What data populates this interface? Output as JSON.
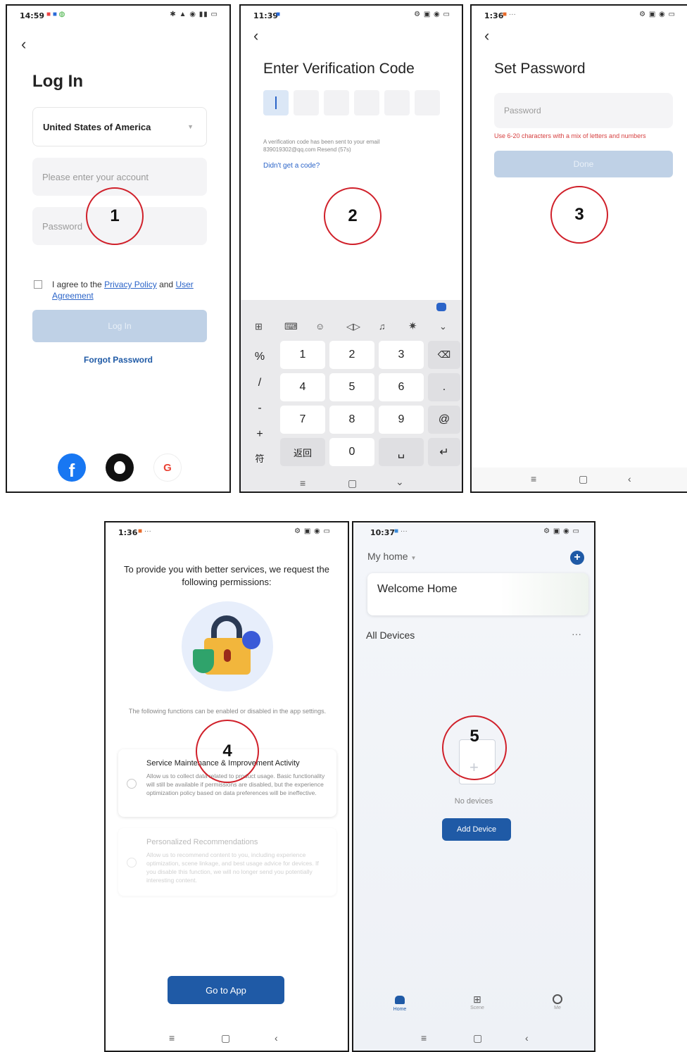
{
  "screen1": {
    "time": "14:59",
    "title": "Log In",
    "country": "United States of America",
    "account_placeholder": "Please enter your account",
    "password_placeholder": "Password",
    "agree_prefix": "I agree to the ",
    "privacy_link": "Privacy Policy",
    "and": " and ",
    "agreement_link": "User Agreement",
    "login_label": "Log In",
    "forgot_label": "Forgot Password",
    "step": "1"
  },
  "screen2": {
    "time": "11:39",
    "title": "Enter Verification Code",
    "sent_text": "A verification code has been sent to your email 839019302@qq.com Resend (57s)",
    "didnt_get": "Didn't get a code?",
    "step": "2",
    "keys": {
      "left": [
        "%",
        "/",
        "-",
        "+"
      ],
      "sym": "符",
      "back_cn": "返回",
      "digits": [
        "1",
        "2",
        "3",
        "4",
        "5",
        "6",
        "7",
        "8",
        "9",
        "0"
      ],
      "dot": ".",
      "at": "@"
    }
  },
  "screen3": {
    "time": "1:36",
    "title": "Set Password",
    "password_placeholder": "Password",
    "hint": "Use 6-20 characters with a mix of letters and numbers",
    "done_label": "Done",
    "step": "3"
  },
  "screen4": {
    "time": "1:36",
    "heading": "To provide you with better services, we request the following permissions:",
    "functions_note": "The following functions can be enabled or disabled in the app settings.",
    "card1_title": "Service Maintenance & Improvement Activity",
    "card1_desc": "Allow us to collect data related to product usage. Basic functionality will still be available if permissions are disabled, but the experience optimization policy based on data preferences will be ineffective.",
    "card2_title": "Personalized Recommendations",
    "card2_desc": "Allow us to recommend content to you, including experience optimization, scene linkage, and best usage advice for devices. If you disable this function, we will no longer send you potentially interesting content.",
    "go_label": "Go to App",
    "step": "4"
  },
  "screen5": {
    "time": "10:37",
    "home_label": "My home",
    "welcome": "Welcome Home",
    "all_devices": "All Devices",
    "no_devices": "No devices",
    "add_device": "Add Device",
    "tabs": [
      "Home",
      "Scene",
      "Me"
    ],
    "step": "5"
  },
  "colors": {
    "accent": "#1f5aa6",
    "link": "#2b64c8",
    "disabled": "#bfd1e6",
    "error": "#d64040",
    "circle": "#d0202a"
  }
}
